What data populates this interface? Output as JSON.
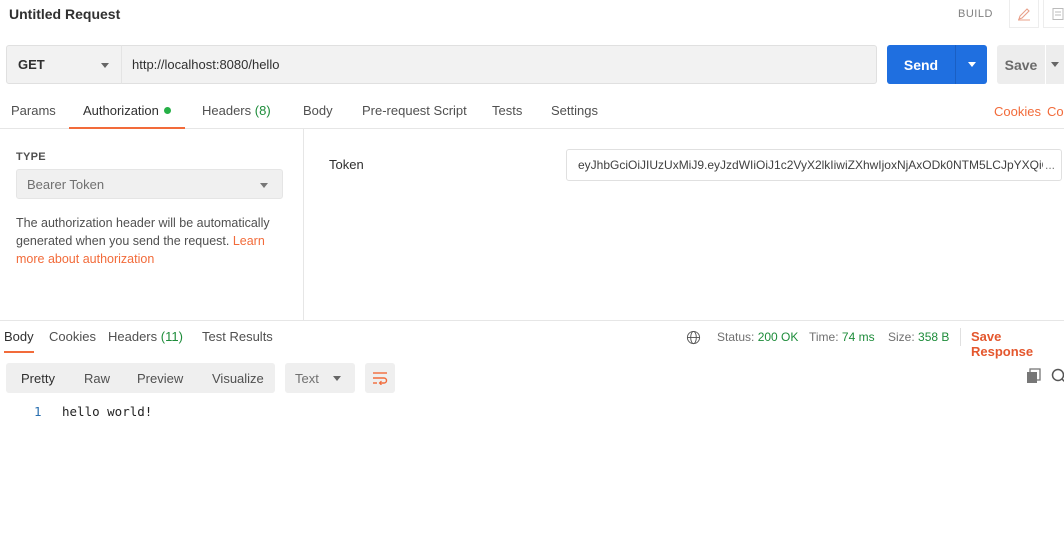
{
  "header": {
    "title": "Untitled Request",
    "build_label": "BUILD",
    "edit_icon": "pencil-icon",
    "doc_icon": "document-icon"
  },
  "request": {
    "method": "GET",
    "url": "http://localhost:8080/hello",
    "send_label": "Send",
    "save_label": "Save"
  },
  "request_tabs": {
    "params": "Params",
    "authorization": "Authorization",
    "headers": "Headers",
    "headers_count": "(8)",
    "body": "Body",
    "pre_request": "Pre-request Script",
    "tests": "Tests",
    "settings": "Settings",
    "cookies": "Cookies",
    "code_partial": "Co"
  },
  "auth": {
    "type_label": "TYPE",
    "type_value": "Bearer Token",
    "description": "The authorization header will be automatically generated when you send the request. ",
    "learn_more": "Learn more about authorization",
    "token_label": "Token",
    "token_value": "eyJhbGciOiJIUzUxMiJ9.eyJzdWIiOiJ1c2VyX2lkIiwiZXhwIjoxNjAxODk0NTM5LCJpYXQiO",
    "token_ellipsis": "..."
  },
  "response_tabs": {
    "body": "Body",
    "cookies": "Cookies",
    "headers": "Headers",
    "headers_count": "(11)",
    "test_results": "Test Results"
  },
  "response_status": {
    "status_label": "Status:",
    "status_value": "200 OK",
    "time_label": "Time:",
    "time_value": "74 ms",
    "size_label": "Size:",
    "size_value": "358 B",
    "save_response": "Save Response"
  },
  "view": {
    "pretty": "Pretty",
    "raw": "Raw",
    "preview": "Preview",
    "visualize": "Visualize",
    "format": "Text"
  },
  "code": {
    "line_number": "1",
    "line_text": "hello world!"
  },
  "colors": {
    "accent": "#f26b3a",
    "send_blue": "#1f6fe0",
    "success_green": "#1d8c3a"
  }
}
